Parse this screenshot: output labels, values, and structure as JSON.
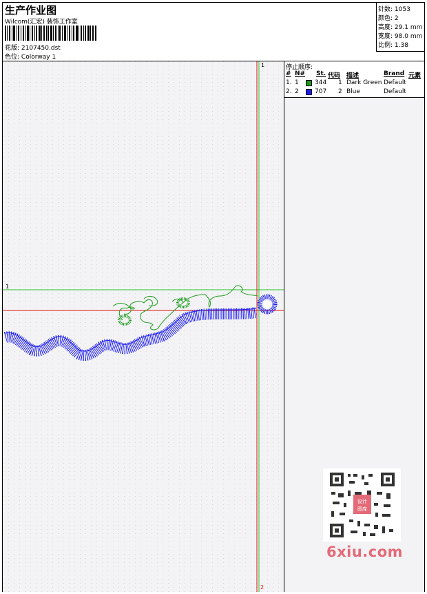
{
  "header": {
    "title": "生产作业图",
    "subtitle": "Wilcom(汇宏) 装饰工作室",
    "design_label": "花版:",
    "design_value": "2107450.dst",
    "colorway_label": "色位:",
    "colorway_value": "Colorway 1"
  },
  "stats": [
    {
      "label": "针数:",
      "value": "1053"
    },
    {
      "label": "颜色:",
      "value": "2"
    },
    {
      "label": "高度:",
      "value": "29.1 mm"
    },
    {
      "label": "宽度:",
      "value": "98.0 mm"
    },
    {
      "label": "比例:",
      "value": "1.38"
    }
  ],
  "stop_sequence": {
    "title": "停止顺序:",
    "headers": {
      "hash": "#",
      "no": "N#",
      "st": "St.",
      "code": "代码",
      "desc": "描述",
      "brand": "Brand",
      "element": "元素"
    },
    "rows": [
      {
        "hash": "1.",
        "no": "1",
        "st": "344",
        "code": "1",
        "desc": "Dark Green",
        "brand": "Default",
        "color": "#1a9a1a"
      },
      {
        "hash": "2.",
        "no": "2",
        "st": "707",
        "code": "2",
        "desc": "Blue",
        "brand": "Default",
        "color": "#1c1cf0"
      }
    ]
  },
  "markers": {
    "top_v": "1",
    "left_h": "1",
    "bottom_v": "2"
  },
  "watermark": {
    "brand": "6xiu.com",
    "seal_text": "设计图库"
  },
  "colors": {
    "green": "#1a9a1a",
    "blue": "#1c1cf0",
    "guide_green": "#22c322",
    "guide_red": "#e01010"
  }
}
